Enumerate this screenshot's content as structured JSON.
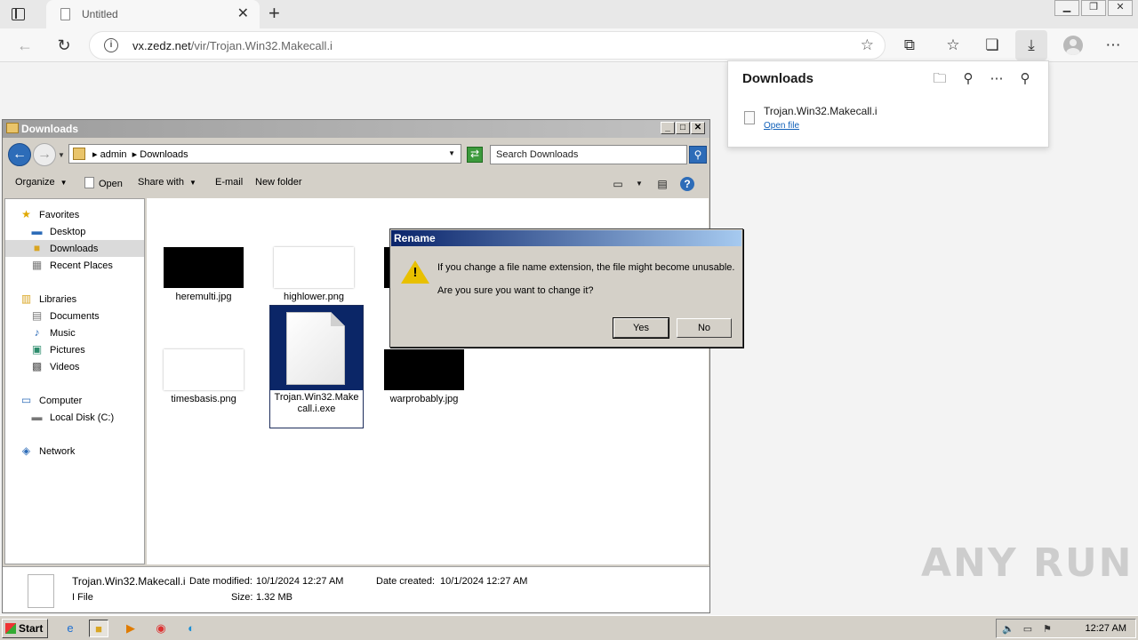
{
  "browser": {
    "tab_title": "Untitled",
    "url_domain": "vx.zedz.net",
    "url_path": "/vir/Trojan.Win32.Makecall.i"
  },
  "downloads_panel": {
    "title": "Downloads",
    "file_name": "Trojan.Win32.Makecall.i",
    "open_label": "Open file"
  },
  "explorer": {
    "title": "Downloads",
    "breadcrumb": [
      "admin",
      "Downloads"
    ],
    "search_placeholder": "Search Downloads",
    "commands": {
      "organize": "Organize",
      "open": "Open",
      "share_with": "Share with",
      "email": "E-mail",
      "new_folder": "New folder"
    },
    "nav": {
      "favorites": "Favorites",
      "desktop": "Desktop",
      "downloads": "Downloads",
      "recent_places": "Recent Places",
      "libraries": "Libraries",
      "documents": "Documents",
      "music": "Music",
      "pictures": "Pictures",
      "videos": "Videos",
      "computer": "Computer",
      "local_disk": "Local Disk (C:)",
      "network": "Network"
    },
    "files": [
      {
        "name": "heremulti.jpg"
      },
      {
        "name": "highlower.png"
      },
      {
        "name": "timesbasis.png"
      },
      {
        "name": "Trojan.Win32.Makecall.i.exe",
        "line1": "Trojan.Win32.Make",
        "line2": "call.i.exe"
      },
      {
        "name": "warprobably.jpg"
      }
    ],
    "details": {
      "name": "Trojan.Win32.Makecall.i",
      "type": "I File",
      "modified_label": "Date modified:",
      "modified_value": "10/1/2024 12:27 AM",
      "size_label": "Size:",
      "size_value": "1.32 MB",
      "created_label": "Date created:",
      "created_value": "10/1/2024 12:27 AM"
    }
  },
  "dialog": {
    "title": "Rename",
    "message1": "If you change a file name extension, the file might become unusable.",
    "message2": "Are you sure you want to change it?",
    "yes_label": "Yes",
    "no_label": "No"
  },
  "watermark": "ANY RUN",
  "taskbar": {
    "start_label": "Start",
    "clock": "12:27 AM"
  }
}
